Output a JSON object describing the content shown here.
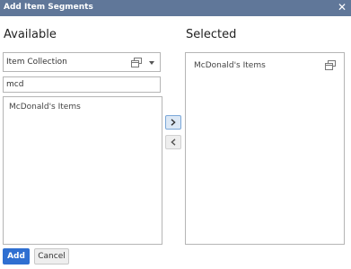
{
  "dialog": {
    "title": "Add Item Segments",
    "close_icon": "close-icon"
  },
  "available": {
    "heading": "Available",
    "collection_select": {
      "value": "Item Collection",
      "icon": "multi-window-icon",
      "dropdown_icon": "caret-down-icon"
    },
    "search": {
      "value": "mcd"
    },
    "items": [
      "McDonald's Items"
    ]
  },
  "transfer": {
    "add_icon": "chevron-right-icon",
    "remove_icon": "chevron-left-icon"
  },
  "selected": {
    "heading": "Selected",
    "items": [
      {
        "label": "McDonald's Items",
        "icon": "multi-window-icon"
      }
    ]
  },
  "footer": {
    "add_label": "Add",
    "cancel_label": "Cancel"
  },
  "colors": {
    "titlebar": "#607799",
    "primary_button": "#2f6fd1",
    "border": "#b5b5b5"
  }
}
